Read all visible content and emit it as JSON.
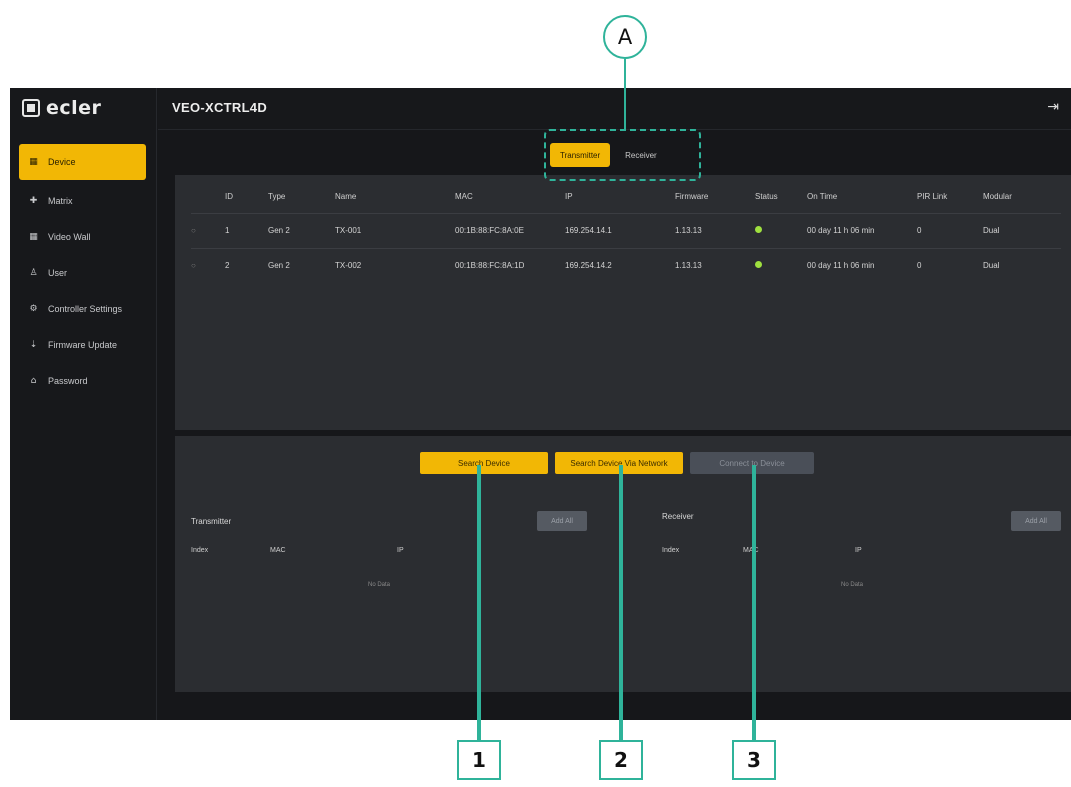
{
  "app": {
    "logo_text": "ecler",
    "device_title": "VEO-XCTRL4D",
    "logout_icon": "logout-icon"
  },
  "sidebar": {
    "items": [
      {
        "label": "Device",
        "icon": "▦",
        "active": true
      },
      {
        "label": "Matrix",
        "icon": "✚",
        "active": false
      },
      {
        "label": "Video Wall",
        "icon": "▦",
        "active": false
      },
      {
        "label": "User",
        "icon": "♙",
        "active": false
      },
      {
        "label": "Controller Settings",
        "icon": "⚙",
        "active": false
      },
      {
        "label": "Firmware Update",
        "icon": "⇣",
        "active": false
      },
      {
        "label": "Password",
        "icon": "⌂",
        "active": false
      }
    ]
  },
  "tabs": {
    "transmitter": "Transmitter",
    "receiver": "Receiver"
  },
  "table": {
    "headers": [
      "",
      "ID",
      "Type",
      "Name",
      "MAC",
      "IP",
      "Firmware",
      "Status",
      "On Time",
      "PIR Link",
      "Modular"
    ],
    "rows": [
      [
        "○",
        "1",
        "Gen 2",
        "TX-001",
        "00:1B:88:FC:8A:0E",
        "169.254.14.1",
        "1.13.13",
        "",
        "00 day 11 h 06 min",
        "0",
        "Dual"
      ],
      [
        "○",
        "2",
        "Gen 2",
        "TX-002",
        "00:1B:88:FC:8A:1D",
        "169.254.14.2",
        "1.13.13",
        "",
        "00 day 11 h 06 min",
        "0",
        "Dual"
      ]
    ]
  },
  "actions": {
    "search": "Search Device",
    "search_all": "Search Device Via Network",
    "third": "Connect to Device"
  },
  "transmitter_panel": {
    "title": "Transmitter",
    "col_index": "Index",
    "col_mac": "MAC",
    "col_ip": "IP",
    "empty": "No Data",
    "button": "Add All"
  },
  "receiver_panel": {
    "title": "Receiver",
    "col_index": "Index",
    "col_mac": "MAC",
    "col_ip": "IP",
    "empty": "No Data",
    "button": "Add All"
  },
  "callouts": {
    "a": "A",
    "one": "1",
    "two": "2",
    "three": "3"
  },
  "colors": {
    "accent": "#f2b705",
    "callout": "#2fb39a",
    "status_online": "#9fe03f"
  }
}
